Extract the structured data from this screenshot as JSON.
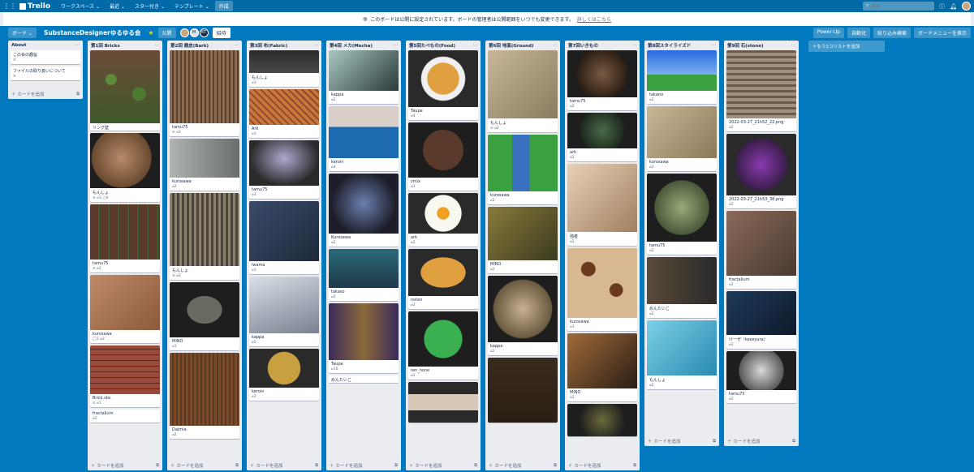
{
  "topbar": {
    "logo": "Trello",
    "workspaces": "ワークスペース ⌄",
    "recent": "最近 ⌄",
    "starred": "スター付き ⌄",
    "templates": "テンプレート ⌄",
    "create": "作成",
    "search_placeholder": "検索"
  },
  "banner": {
    "text": "このボードは公開に設定されています。ボードの管理者は公開範囲をいつでも変更できます。",
    "link": "詳しくはこちら"
  },
  "boardbar": {
    "board_menu": "ボード ⌄",
    "title": "SubstanceDesignerゆるゆる会",
    "visibility": "公開",
    "member_initials": [
      "M",
      "KT"
    ],
    "invite": "招待",
    "powerup": "Power-Up",
    "automation": "自動化",
    "filter": "絞り込み検索",
    "show_menu": "ボードメニューを表示"
  },
  "add_card": "カードを追加",
  "add_list": "もう1つリストを追加",
  "lists": [
    {
      "title": "About",
      "cards": [
        {
          "title": "この会の趣旨",
          "meta": "≡",
          "img": ""
        },
        {
          "title": "ファイルの取り扱いについて",
          "meta": "≡",
          "img": ""
        }
      ]
    },
    {
      "title": "第1回 Bricks",
      "cards": [
        {
          "title": "リング壁",
          "meta": "",
          "img": "ivy"
        },
        {
          "title": "もんしょ",
          "meta": "≡ ⌀3 ▢4",
          "img": "brickball"
        },
        {
          "title": "tamu75",
          "meta": "≡ ⌀2",
          "img": "brickmoss"
        },
        {
          "title": "kurosawa",
          "meta": "◯1 ⌀2",
          "img": "brickcube"
        },
        {
          "title": "Brick.sbs",
          "meta": "≡ ⌀1",
          "img": "brickwall"
        },
        {
          "title": "fractalium",
          "meta": "⌀2",
          "img": ""
        }
      ]
    },
    {
      "title": "第2回 樹皮(Bark)",
      "cards": [
        {
          "title": "tamu75",
          "meta": "≡ ⌀2",
          "img": "barkcyl"
        },
        {
          "title": "kurosawa",
          "meta": "⌀2",
          "img": "barkgrey"
        },
        {
          "title": "もんしょ",
          "meta": "≡ ⌀2",
          "img": "barkcyl2"
        },
        {
          "title": "MINO",
          "meta": "⌀3",
          "img": "barkdark"
        },
        {
          "title": "Daimia",
          "meta": "⌀2",
          "img": "wood"
        }
      ]
    },
    {
      "title": "第3回 布(Fabric)",
      "cards": [
        {
          "title": "もんしょ",
          "meta": "⌀3",
          "img": "fabrictiles"
        },
        {
          "title": "Ark",
          "meta": "⌀3",
          "img": "fabrictent"
        },
        {
          "title": "tamu75",
          "meta": "⌀3",
          "img": "fabriccloth"
        },
        {
          "title": "iwama",
          "meta": "⌀3",
          "img": "fabriccube"
        },
        {
          "title": "kappa",
          "meta": "⌀5",
          "img": "fabricdrape"
        },
        {
          "title": "keroin",
          "meta": "⌀2",
          "img": "fabricpatch"
        }
      ]
    },
    {
      "title": "第4回 メカ(Mecha)",
      "cards": [
        {
          "title": "kappa",
          "meta": "⌀2",
          "img": "mechatiles"
        },
        {
          "title": "keroin",
          "meta": "⌀4",
          "img": "mechapanel"
        },
        {
          "title": "Kurosawa",
          "meta": "⌀2",
          "img": "mechasphere"
        },
        {
          "title": "takaso",
          "meta": "⌀2",
          "img": "mechatech"
        },
        {
          "title": "Taupe",
          "meta": "⌀10",
          "img": "mechacyl"
        },
        {
          "title": "めんたいこ",
          "meta": "",
          "img": ""
        }
      ]
    },
    {
      "title": "第5回たべもの(Food)",
      "cards": [
        {
          "title": "Taupe",
          "meta": "⌀4",
          "img": "ramen"
        },
        {
          "title": "zmix",
          "meta": "⌀3",
          "img": "pie"
        },
        {
          "title": "ark",
          "meta": "⌀2",
          "img": "egg"
        },
        {
          "title": "noten",
          "meta": "⌀2",
          "img": "pizza"
        },
        {
          "title": "ren_none",
          "meta": "⌀2",
          "img": "melon"
        },
        {
          "title": "",
          "meta": "",
          "img": "roll"
        }
      ]
    },
    {
      "title": "第6回 地面(Ground)",
      "cards": [
        {
          "title": "もんしょ",
          "meta": "≡ ⌀2",
          "img": "groundcube"
        },
        {
          "title": "kurosawa",
          "meta": "⌀2",
          "img": "river"
        },
        {
          "title": "MINO",
          "meta": "⌀2",
          "img": "moss"
        },
        {
          "title": "kappa",
          "meta": "⌀2",
          "img": "groundball"
        },
        {
          "title": "",
          "meta": "",
          "img": "dirt"
        }
      ]
    },
    {
      "title": "第7回いきもの",
      "cards": [
        {
          "title": "tamu75",
          "meta": "⌀2",
          "img": "skinball"
        },
        {
          "title": "ark",
          "meta": "⌀2",
          "img": "scaleball"
        },
        {
          "title": "強者",
          "meta": "⌀2",
          "img": "kanjicube"
        },
        {
          "title": "kurosawa",
          "meta": "⌀3",
          "img": "giraffe"
        },
        {
          "title": "MINO",
          "meta": "⌀2",
          "img": "scalecube"
        },
        {
          "title": "",
          "meta": "",
          "img": "snakeball"
        }
      ]
    },
    {
      "title": "第8回スタイライズド",
      "cards": [
        {
          "title": "takano",
          "meta": "⌀2",
          "img": "sky"
        },
        {
          "title": "kurosawa",
          "meta": "⌀2",
          "img": "sand"
        },
        {
          "title": "tamu75",
          "meta": "⌀2",
          "img": "pavingball"
        },
        {
          "title": "めんたいこ",
          "meta": "⌀2",
          "img": "stonecyl"
        },
        {
          "title": "もんしょ",
          "meta": "⌀2",
          "img": "water"
        }
      ]
    },
    {
      "title": "第9回 石(stone)",
      "cards": [
        {
          "title": "2022-03-27_21h52_22.png",
          "meta": "⌀2",
          "img": "stonecylinder"
        },
        {
          "title": "2022-03-27_21h53_38.png",
          "meta": "⌀2",
          "img": "purple"
        },
        {
          "title": "fractalium",
          "meta": "⌀2",
          "img": "rock"
        },
        {
          "title": "けーぜ（keseyura）",
          "meta": "⌀2",
          "img": "cracks"
        },
        {
          "title": "tamu75",
          "meta": "⌀2",
          "img": "stoneball"
        }
      ]
    }
  ]
}
